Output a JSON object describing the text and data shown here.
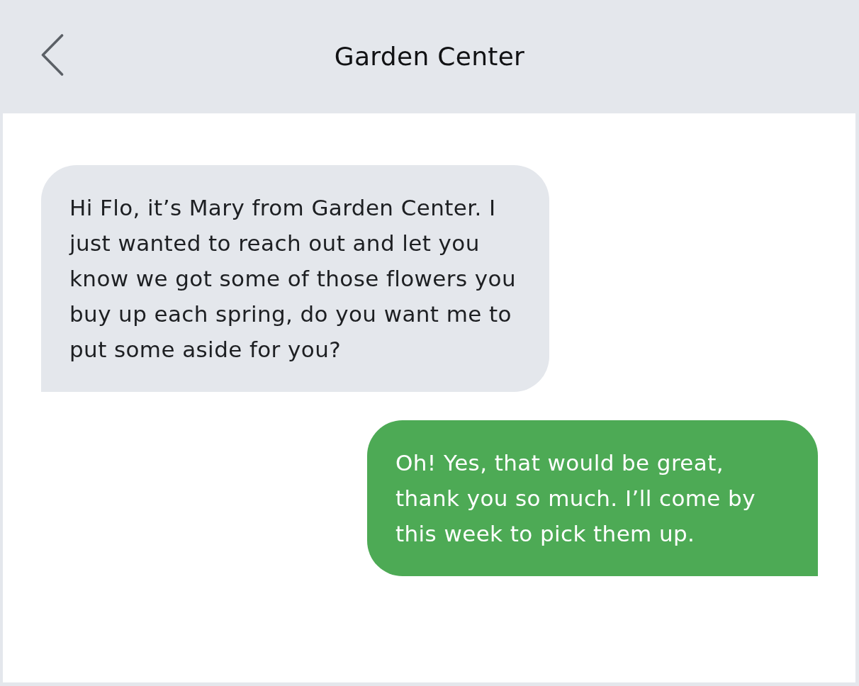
{
  "header": {
    "title": "Garden Center"
  },
  "messages": [
    {
      "kind": "received",
      "text": "Hi Flo, it’s Mary from Garden Center. I just wanted to reach out and let you know we got some of those flowers you buy up each spring, do you want me to put some aside for you?"
    },
    {
      "kind": "sent",
      "text": "Oh! Yes, that would be great, thank you so much. I’ll come by this week to pick them up."
    }
  ]
}
